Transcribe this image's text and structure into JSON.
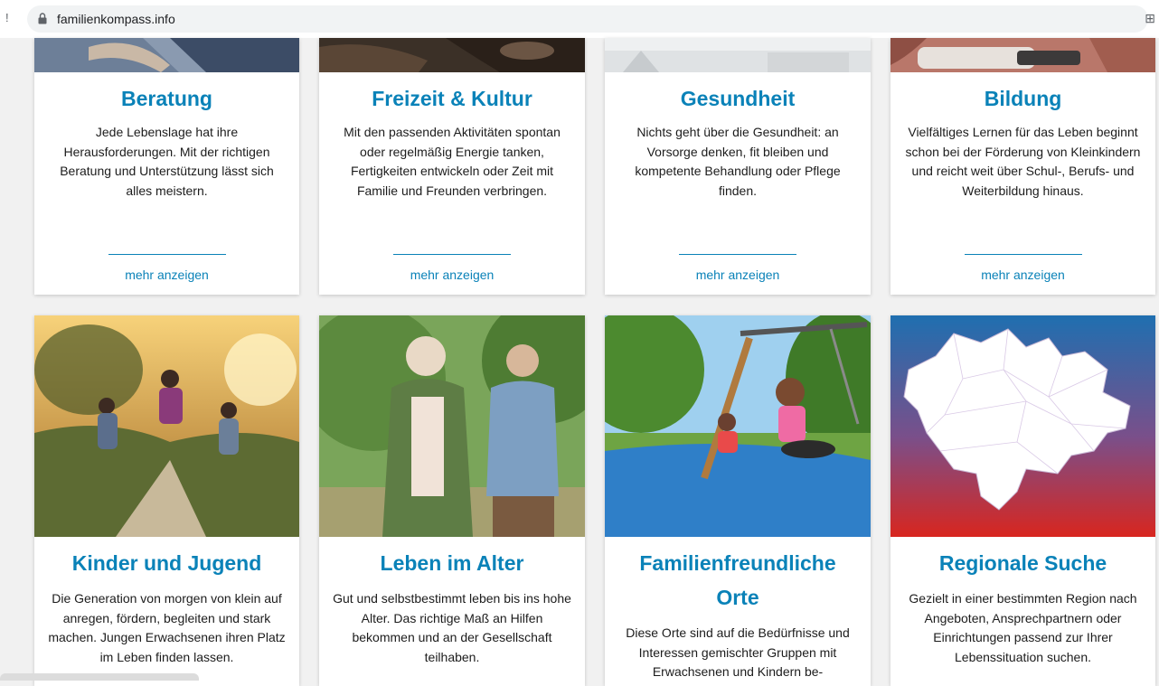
{
  "browser": {
    "url": "familienkompass.info"
  },
  "top_cards": [
    {
      "title": "Beratung",
      "text": "Jede Lebenslage hat ihre Herausforderungen. Mit der richtigen Beratung und Unterstützung lässt sich alles meistern.",
      "link": "mehr anzeigen"
    },
    {
      "title": "Freizeit & Kultur",
      "text": "Mit den passenden Aktivitäten spontan oder regelmäßig Energie tanken, Fertigkeiten entwickeln oder Zeit mit Familie und Freunden verbringen.",
      "link": "mehr anzeigen"
    },
    {
      "title": "Gesundheit",
      "text": "Nichts geht über die Gesundheit: an Vorsorge denken, fit bleiben und kompetente Behandlung oder Pflege finden.",
      "link": "mehr anzeigen"
    },
    {
      "title": "Bildung",
      "text": "Vielfältiges Lernen für das Leben beginnt schon bei der Förderung von Kleinkindern und reicht weit über Schul-, Berufs- und Weiterbildung hinaus.",
      "link": "mehr anzeigen"
    }
  ],
  "bottom_cards": [
    {
      "title": "Kinder und Jugend",
      "text": "Die Generation von morgen von klein auf anregen, fördern, begleiten und stark machen. Jungen Erwachsenen ihren Platz im Leben finden lassen."
    },
    {
      "title": "Leben im Alter",
      "text": "Gut und selbstbestimmt leben bis ins hohe Alter. Das richtige Maß an Hilfen bekommen und an der Gesellschaft teilhaben."
    },
    {
      "title": "Familienfreundliche Orte",
      "text": "Diese Orte sind auf die Bedürfnisse und Interessen gemischter Gruppen mit Erwachsenen und Kindern be-"
    },
    {
      "title": "Regionale Suche",
      "text": "Gezielt in einer bestimmten Region nach Angeboten, Ansprechpartnern oder Einrichtungen passend zur Ihrer Lebenssituation suchen."
    }
  ],
  "colors": {
    "accent": "#0a82b8",
    "page_bg": "#f1f1f1",
    "map_top": "#1f6fb0",
    "map_bottom": "#d8261f"
  },
  "icons": [
    "lock-icon",
    "extensions-icon"
  ]
}
